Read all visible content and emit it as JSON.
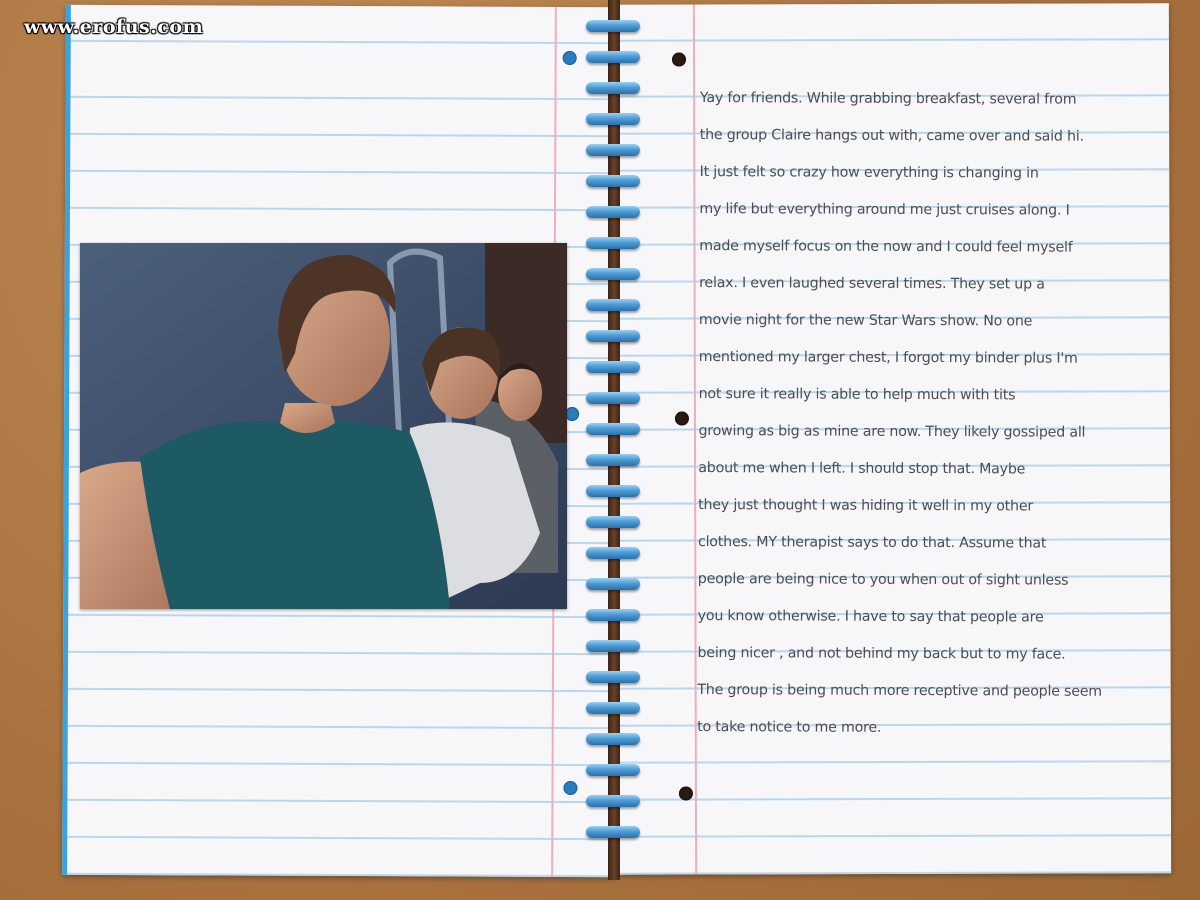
{
  "watermark": {
    "text": "www.erofus.com"
  },
  "notebook": {
    "photo_description_name": "selfie-photo",
    "journal_lines": [
      "Yay for friends. While grabbing breakfast, several from",
      "the group Claire hangs out with, came over and said hi.",
      "It just felt so crazy how everything is changing in",
      "my life but everything around me just cruises along. I",
      "made myself focus on the now and I could feel myself",
      "relax. I even laughed several times. They set up a",
      "movie night for the new Star Wars show. No one",
      "mentioned my larger chest, I forgot my binder plus I'm",
      "not sure it really is able to help much with tits",
      "growing as big as mine are now. They likely gossiped all",
      "about me when I left. I should stop that. Maybe",
      "they just thought I was hiding it well in my other",
      "clothes. MY therapist says to do that. Assume that",
      "people are being nice to you when out of sight unless",
      "you know otherwise. I have to say that people are",
      "being nicer , and not behind my back but to my face.",
      "The group is being much more receptive and people seem",
      "to take notice to me more."
    ]
  },
  "colors": {
    "desk": "#b07a45",
    "paper": "#f7f6f8",
    "rule_line": "#b9d6ef",
    "margin_line": "#f0aebd",
    "coil": "#4d9dd6",
    "ink": "#4c4c52"
  }
}
